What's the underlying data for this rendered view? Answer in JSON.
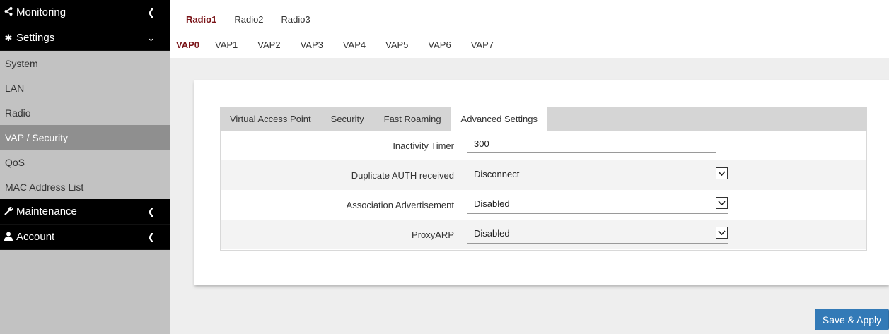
{
  "sidebar": {
    "monitoring_label": "Monitoring",
    "settings_label": "Settings",
    "settings_items": [
      "System",
      "LAN",
      "Radio",
      "VAP / Security",
      "QoS",
      "MAC Address List"
    ],
    "maintenance_label": "Maintenance",
    "account_label": "Account"
  },
  "radio_tabs": [
    "Radio1",
    "Radio2",
    "Radio3"
  ],
  "vap_tabs": [
    "VAP0",
    "VAP1",
    "VAP2",
    "VAP3",
    "VAP4",
    "VAP5",
    "VAP6",
    "VAP7"
  ],
  "inner_tabs": [
    "Virtual Access Point",
    "Security",
    "Fast Roaming",
    "Advanced Settings"
  ],
  "form": {
    "inactivity_timer_label": "Inactivity Timer",
    "inactivity_timer_value": "300",
    "duplicate_auth_label": "Duplicate AUTH received",
    "duplicate_auth_value": "Disconnect",
    "association_adv_label": "Association Advertisement",
    "association_adv_value": "Disabled",
    "proxyarp_label": "ProxyARP",
    "proxyarp_value": "Disabled"
  },
  "save_label": "Save & Apply",
  "colors": {
    "accent": "#7a1418",
    "button": "#337ab7",
    "sidebar_bg": "#c2c2c2",
    "sidebar_active": "#8f8f8f",
    "header_bg": "#000000"
  }
}
